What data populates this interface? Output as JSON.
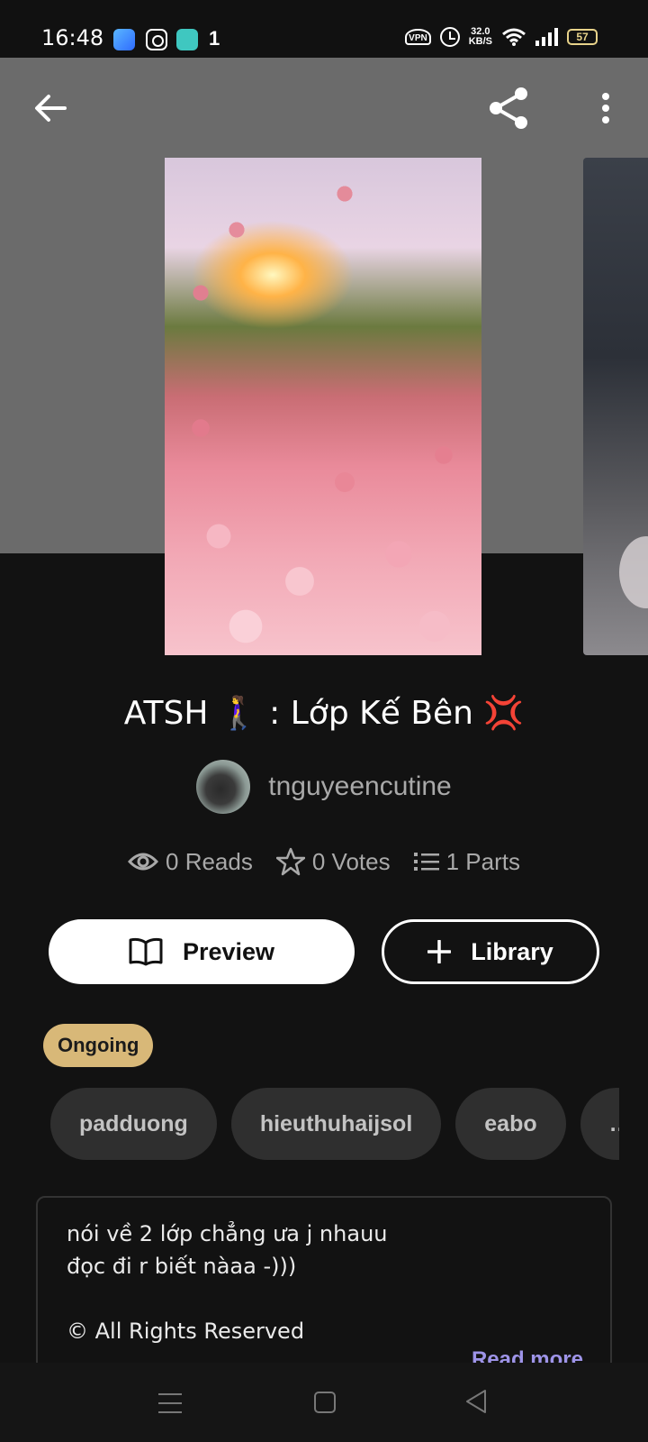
{
  "status_bar": {
    "time": "16:48",
    "notification_count": "1",
    "speed_value": "32.0",
    "speed_unit": "KB/S",
    "vpn_label": "VPN",
    "battery": "57"
  },
  "header": {
    "back_icon": "arrow-left-icon",
    "share_icon": "share-icon",
    "more_icon": "more-vertical-icon"
  },
  "story": {
    "title": "ATSH 🚶‍♀️ : Lớp Kế Bên 💢",
    "author": "tnguyeencutine",
    "stats": {
      "reads": "0 Reads",
      "votes": "0 Votes",
      "parts": "1 Parts"
    },
    "status": "Ongoing",
    "tags": [
      "padduong",
      "hieuthuhaijsol",
      "eabo",
      "…"
    ],
    "description": "nói về 2 lớp chẳng ưa j nhauu\nđọc đi r biết nàaa -)))\n\n© All Rights Reserved",
    "read_more": "Read more"
  },
  "actions": {
    "preview_label": "Preview",
    "library_label": "Library"
  },
  "colors": {
    "background": "#121212",
    "header_grey": "#6b6b6b",
    "status_badge": "#d8b878",
    "tag_bg": "#2f2f2f",
    "read_more": "#9e94e8"
  }
}
